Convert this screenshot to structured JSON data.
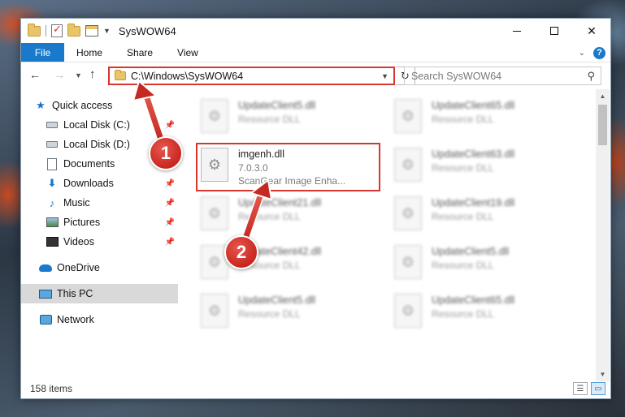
{
  "window": {
    "title": "SysWOW64"
  },
  "ribbon": {
    "tabs": [
      "File",
      "Home",
      "Share",
      "View"
    ]
  },
  "address": {
    "path": "C:\\Windows\\SysWOW64"
  },
  "search": {
    "placeholder": "Search SysWOW64"
  },
  "nav": {
    "items": [
      {
        "label": "Quick access",
        "icon": "star-icon"
      },
      {
        "label": "Local Disk (C:)",
        "icon": "drive-icon",
        "pinned": true
      },
      {
        "label": "Local Disk (D:)",
        "icon": "drive-icon"
      },
      {
        "label": "Documents",
        "icon": "document-icon",
        "pinned": true
      },
      {
        "label": "Downloads",
        "icon": "download-icon",
        "pinned": true
      },
      {
        "label": "Music",
        "icon": "music-icon",
        "pinned": true
      },
      {
        "label": "Pictures",
        "icon": "picture-icon",
        "pinned": true
      },
      {
        "label": "Videos",
        "icon": "video-icon",
        "pinned": true
      },
      {
        "label": "OneDrive",
        "icon": "cloud-icon"
      },
      {
        "label": "This PC",
        "icon": "computer-icon",
        "selected": true
      },
      {
        "label": "Network",
        "icon": "network-icon"
      }
    ]
  },
  "files": [
    {
      "name": "UpdateClient5.dll",
      "sub1": "Resource DLL",
      "sub2": "",
      "blurred": true
    },
    {
      "name": "UpdateClient65.dll",
      "sub1": "Resource DLL",
      "sub2": "",
      "blurred": true
    },
    {
      "name": "imgenh.dll",
      "sub1": "7.0.3.0",
      "sub2": "ScanGear Image Enha...",
      "blurred": false
    },
    {
      "name": "UpdateClient63.dll",
      "sub1": "Resource DLL",
      "sub2": "",
      "blurred": true
    },
    {
      "name": "UpdateClient21.dll",
      "sub1": "Resource DLL",
      "sub2": "",
      "blurred": true
    },
    {
      "name": "UpdateClient19.dll",
      "sub1": "Resource DLL",
      "sub2": "",
      "blurred": true
    },
    {
      "name": "UpdateClient42.dll",
      "sub1": "Resource DLL",
      "sub2": "",
      "blurred": true
    },
    {
      "name": "UpdateClient5.dll",
      "sub1": "Resource DLL",
      "sub2": "",
      "blurred": true
    },
    {
      "name": "UpdateClient5.dll",
      "sub1": "Resource DLL",
      "sub2": "",
      "blurred": true
    },
    {
      "name": "UpdateClient65.dll",
      "sub1": "Resource DLL",
      "sub2": "",
      "blurred": true
    }
  ],
  "status": {
    "item_count": "158 items"
  },
  "callouts": [
    "1",
    "2"
  ],
  "colors": {
    "accent": "#1979ca",
    "highlight": "#d6362e"
  }
}
